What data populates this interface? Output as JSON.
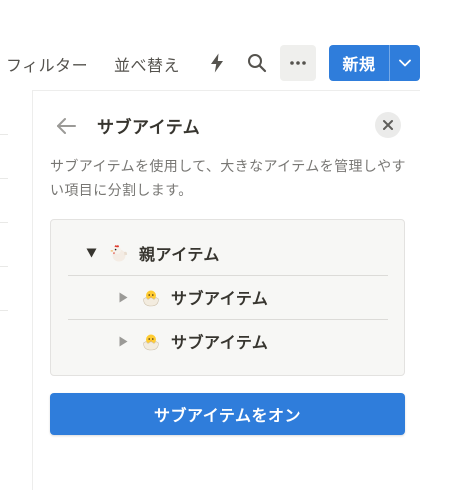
{
  "toolbar": {
    "filter_label": "フィルター",
    "sort_label": "並べ替え",
    "new_label": "新規",
    "icons": [
      "bolt-icon",
      "search-icon",
      "more-icon",
      "chevron-down-icon"
    ]
  },
  "panel": {
    "title": "サブアイテム",
    "description": "サブアイテムを使用して、大きなアイテムを管理しやすい項目に分割します。",
    "tree": {
      "parent": {
        "label": "親アイテム",
        "icon": "chicken-emoji",
        "expanded": true
      },
      "children": [
        {
          "label": "サブアイテム",
          "icon": "hatching-chick-emoji",
          "expanded": false
        },
        {
          "label": "サブアイテム",
          "icon": "hatching-chick-emoji",
          "expanded": false
        }
      ]
    },
    "turn_on_label": "サブアイテムをオン"
  },
  "colors": {
    "accent": "#2f7ddb",
    "text": "#37352f",
    "muted": "#787774",
    "tree_bg": "#f7f7f5"
  }
}
